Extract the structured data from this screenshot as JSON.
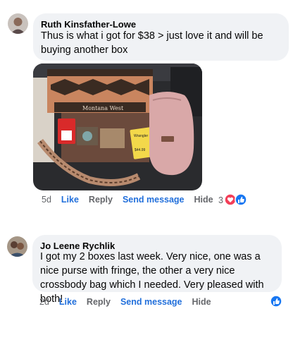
{
  "comments": [
    {
      "author": "Ruth Kinsfather-Lowe",
      "text": "Thus is what i got for $38 > just love it and will be buying another box",
      "time": "5d",
      "like": "Like",
      "reply": "Reply",
      "send": "Send message",
      "hide": "Hide",
      "reaction_count": "3",
      "photo": {
        "brand_text": "Montana West",
        "tag_text": "Wrangler",
        "price_text": "$44.99"
      }
    },
    {
      "author": "Jo Leene Rychlik",
      "text": "I got my 2 boxes last week. Very nice, one was a nice purse with fringe, the other a very nice crossbody bag which I needed. Very pleased with both!",
      "time": "2d",
      "like": "Like",
      "reply": "Reply",
      "send": "Send message",
      "hide": "Hide"
    }
  ],
  "colors": {
    "like_blue": "#216fdb",
    "love_red": "#f33e58",
    "bubble": "#f0f2f5",
    "meta_gray": "#65676b"
  }
}
